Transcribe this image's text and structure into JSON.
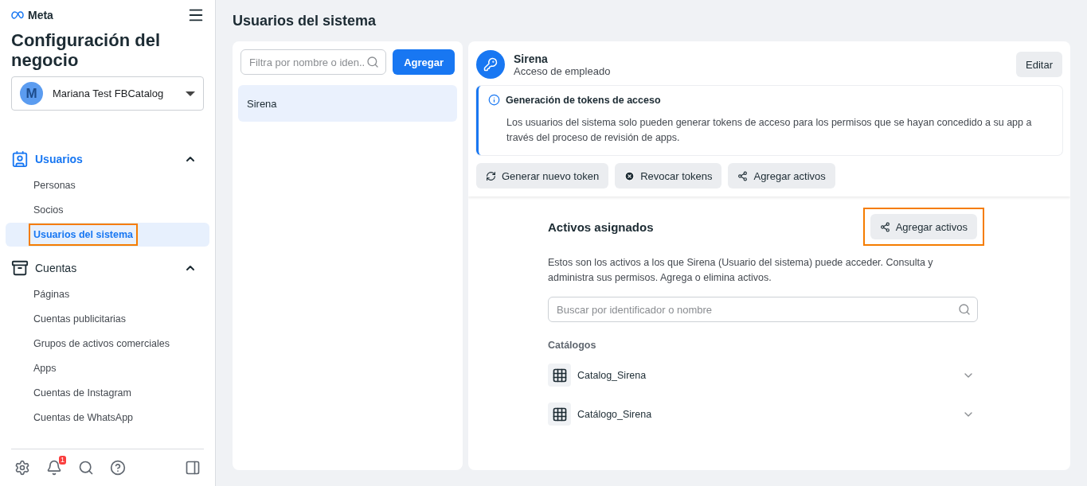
{
  "brand": "Meta",
  "sidebar": {
    "title": "Configuración del negocio",
    "account": {
      "initial": "M",
      "name": "Mariana Test FBCatalog"
    },
    "sections": [
      {
        "kind": "users",
        "label": "Usuarios",
        "active": true,
        "expanded": true,
        "items": [
          {
            "label": "Personas",
            "selected": false,
            "highlighted": false
          },
          {
            "label": "Socios",
            "selected": false,
            "highlighted": false
          },
          {
            "label": "Usuarios del sistema",
            "selected": true,
            "highlighted": true
          }
        ]
      },
      {
        "kind": "accounts",
        "label": "Cuentas",
        "active": false,
        "expanded": true,
        "items": [
          {
            "label": "Páginas",
            "selected": false,
            "highlighted": false
          },
          {
            "label": "Cuentas publicitarias",
            "selected": false,
            "highlighted": false
          },
          {
            "label": "Grupos de activos comerciales",
            "selected": false,
            "highlighted": false
          },
          {
            "label": "Apps",
            "selected": false,
            "highlighted": false
          },
          {
            "label": "Cuentas de Instagram",
            "selected": false,
            "highlighted": false
          },
          {
            "label": "Cuentas de WhatsApp",
            "selected": false,
            "highlighted": false
          }
        ]
      }
    ],
    "notification_count": "1"
  },
  "page_title": "Usuarios del sistema",
  "user_list": {
    "filter_placeholder": "Filtra por nombre o iden...",
    "add_button": "Agregar",
    "users": [
      {
        "name": "Sirena",
        "selected": true
      }
    ]
  },
  "detail": {
    "name": "Sirena",
    "role": "Acceso de empleado",
    "edit_button": "Editar",
    "notice": {
      "title": "Generación de tokens de acceso",
      "body": "Los usuarios del sistema solo pueden generar tokens de acceso para los permisos que se hayan concedido a su app a través del proceso de revisión de apps."
    },
    "actions": [
      {
        "kind": "refresh",
        "label": "Generar nuevo token"
      },
      {
        "kind": "revoke",
        "label": "Revocar tokens"
      },
      {
        "kind": "assets",
        "label": "Agregar activos"
      }
    ],
    "assets": {
      "title": "Activos asignados",
      "add_button": {
        "label": "Agregar activos",
        "highlighted": true
      },
      "description": "Estos son los activos a los que Sirena (Usuario del sistema) puede acceder. Consulta y administra sus permisos. Agrega o elimina activos.",
      "search_placeholder": "Buscar por identificador o nombre",
      "group_title": "Catálogos",
      "items": [
        {
          "name": "Catalog_Sirena",
          "expanded": false
        },
        {
          "name": "Catálogo_Sirena",
          "expanded": false
        }
      ]
    }
  }
}
